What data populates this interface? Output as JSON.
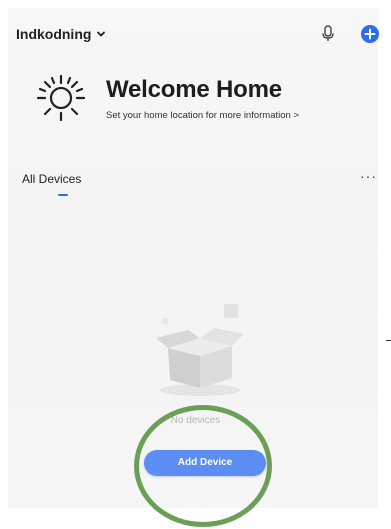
{
  "header": {
    "home_name": "Indkodning",
    "icons": {
      "dropdown": "chevron-down-icon",
      "microphone": "microphone-icon",
      "add": "plus-circle-icon"
    },
    "accent_color": "#2d6bf3"
  },
  "weather": {
    "icon": "sun-icon",
    "title": "Welcome Home",
    "subtitle": "Set your home location for more information >"
  },
  "devices": {
    "tab_label": "All Devices",
    "more_label": "···",
    "empty_text": "No devices",
    "add_button_label": "Add Device",
    "add_button_color": "#5b8df2"
  },
  "annotation": {
    "ring_color": "#6aa055"
  }
}
